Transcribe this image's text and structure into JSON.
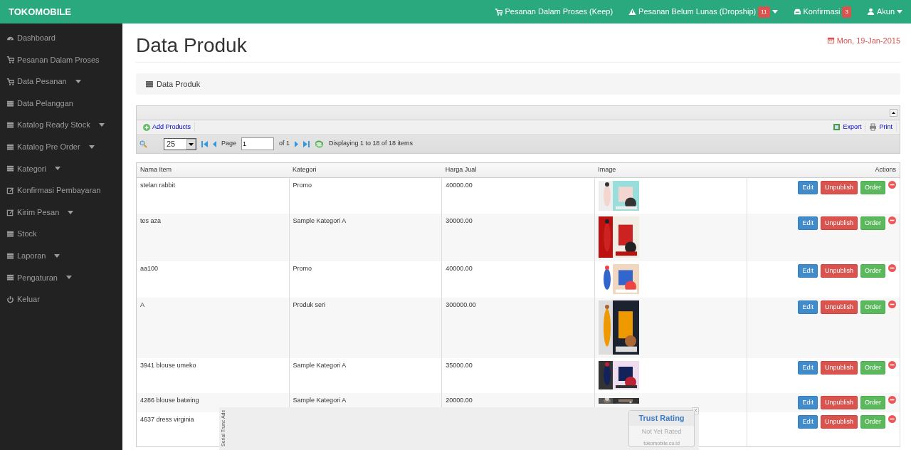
{
  "navbar": {
    "brand": "TOKOMOBILE",
    "items": [
      {
        "label": "Pesanan Dalam Proses (Keep)",
        "dropdown": false
      },
      {
        "label": "Pesanan Belum Lunas (Dropship)",
        "badge": "11",
        "dropdown": true
      },
      {
        "label": "Konfirmasi",
        "badge": "3",
        "dropdown": false
      },
      {
        "label": "Akun",
        "dropdown": true
      }
    ]
  },
  "sidebar": {
    "items": [
      {
        "label": "Dashboard",
        "dropdown": false
      },
      {
        "label": "Pesanan Dalam Proses",
        "dropdown": false
      },
      {
        "label": "Data Pesanan",
        "dropdown": true
      },
      {
        "label": "Data Pelanggan",
        "dropdown": false
      },
      {
        "label": "Katalog Ready Stock",
        "dropdown": true
      },
      {
        "label": "Katalog Pre Order",
        "dropdown": true
      },
      {
        "label": "Kategori",
        "dropdown": true
      },
      {
        "label": "Konfirmasi Pembayaran",
        "dropdown": false
      },
      {
        "label": "Kirim Pesan",
        "dropdown": true
      },
      {
        "label": "Stock",
        "dropdown": false
      },
      {
        "label": "Laporan",
        "dropdown": true
      },
      {
        "label": "Pengaturan",
        "dropdown": true
      },
      {
        "label": "Keluar",
        "dropdown": false
      }
    ]
  },
  "page": {
    "title": "Data Produk",
    "date": "Mon, 19-Jan-2015",
    "breadcrumb": "Data Produk"
  },
  "grid": {
    "toolbar": {
      "add": "Add Products",
      "export": "Export",
      "print": "Print"
    },
    "pager": {
      "page_size": "25",
      "page_label": "Page",
      "page": "1",
      "of": "of 1",
      "info": "Displaying 1 to 18 of 18 items"
    },
    "columns": [
      "Nama Item",
      "Kategori",
      "Harga Jual",
      "Image",
      "Actions"
    ],
    "rows": [
      {
        "name": "stelan rabbit",
        "category": "Promo",
        "price": "40000.00",
        "image": {
          "kind": "picture"
        },
        "buttons": [
          "Edit",
          "Unpublish",
          "Order"
        ]
      },
      {
        "name": "tes aza",
        "category": "Sample Kategori A",
        "price": "30000.00",
        "image": {
          "kind": "picture"
        },
        "buttons": [
          "Edit",
          "Unpublish",
          "Order"
        ]
      },
      {
        "name": "aa100",
        "category": "Promo",
        "price": "40000.00",
        "image": {
          "kind": "picture"
        },
        "buttons": [
          "Edit",
          "Unpublish",
          "Order"
        ]
      },
      {
        "name": "A",
        "category": "Produk seri",
        "price": "300000.00",
        "image": {
          "kind": "picture"
        },
        "buttons": [
          "Edit",
          "Unpublish",
          "Order"
        ]
      },
      {
        "name": "3941 blouse umeko",
        "category": "Sample Kategori A",
        "price": "35000.00",
        "image": {
          "kind": "picture"
        },
        "buttons": [
          "Edit",
          "Unpublish",
          "Order"
        ]
      },
      {
        "name": "4286 blouse batwing",
        "category": "Sample Kategori A",
        "price": "20000.00",
        "image": {
          "kind": "picture"
        },
        "buttons": [
          "Edit",
          "Unpublish",
          "Order"
        ]
      },
      {
        "name": "4637 dress virginia",
        "buttons": [
          "Edit",
          "Unpublish",
          "Order"
        ]
      }
    ]
  },
  "ad_overlay": {
    "side_label": "Serial Trunc Ads",
    "close": "X",
    "trust": {
      "title": "Trust Rating",
      "status": "Not Yet Rated",
      "site": "tokomobile.co.id"
    }
  }
}
